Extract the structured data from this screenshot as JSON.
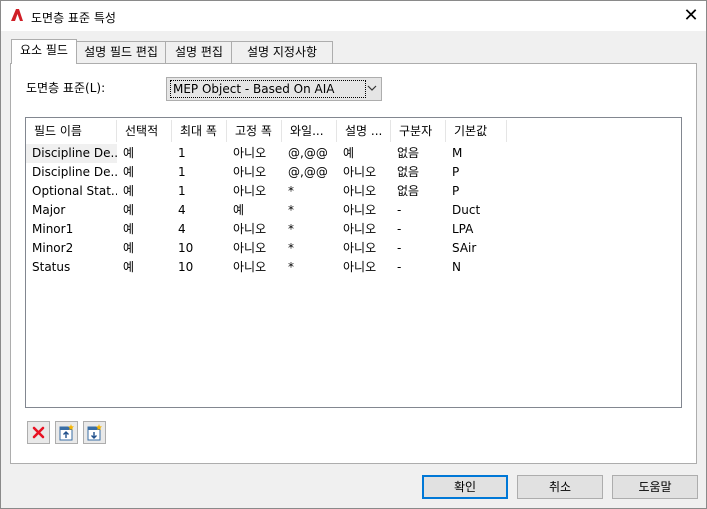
{
  "window": {
    "title": "도면층 표준 특성",
    "close_symbol": "✕"
  },
  "tabs": [
    {
      "label": "요소 필드",
      "active": true
    },
    {
      "label": "설명 필드 편집",
      "active": false
    },
    {
      "label": "설명 편집",
      "active": false
    },
    {
      "label": "설명 지정사항",
      "active": false
    }
  ],
  "standard": {
    "label": "도면층 표준(L):",
    "selected": "MEP Object - Based On AIA"
  },
  "grid": {
    "columns": [
      "필드 이름",
      "선택적",
      "최대 폭",
      "고정 폭",
      "와일...",
      "설명 ...",
      "구분자",
      "기본값"
    ],
    "rows": [
      [
        "Discipline De...",
        "예",
        "1",
        "아니오",
        "@,@@",
        "예",
        "없음",
        "M"
      ],
      [
        "Discipline De...",
        "예",
        "1",
        "아니오",
        "@,@@",
        "아니오",
        "없음",
        "P"
      ],
      [
        "Optional Stat...",
        "예",
        "1",
        "아니오",
        "*",
        "아니오",
        "없음",
        "P"
      ],
      [
        "Major",
        "예",
        "4",
        "예",
        "*",
        "아니오",
        "-",
        "Duct"
      ],
      [
        "Minor1",
        "예",
        "4",
        "아니오",
        "*",
        "아니오",
        "-",
        "LPA"
      ],
      [
        "Minor2",
        "예",
        "10",
        "아니오",
        "*",
        "아니오",
        "-",
        "SAir"
      ],
      [
        "Status",
        "예",
        "10",
        "아니오",
        "*",
        "아니오",
        "-",
        "N"
      ]
    ]
  },
  "toolbar": {
    "icons": [
      "delete-icon",
      "insert-above-icon",
      "insert-below-icon"
    ]
  },
  "buttons": {
    "ok": "확인",
    "cancel": "취소",
    "help": "도움말"
  },
  "colors": {
    "accent": "#0078d7",
    "delete": "#e81123",
    "app_icon": "#d01f27"
  }
}
